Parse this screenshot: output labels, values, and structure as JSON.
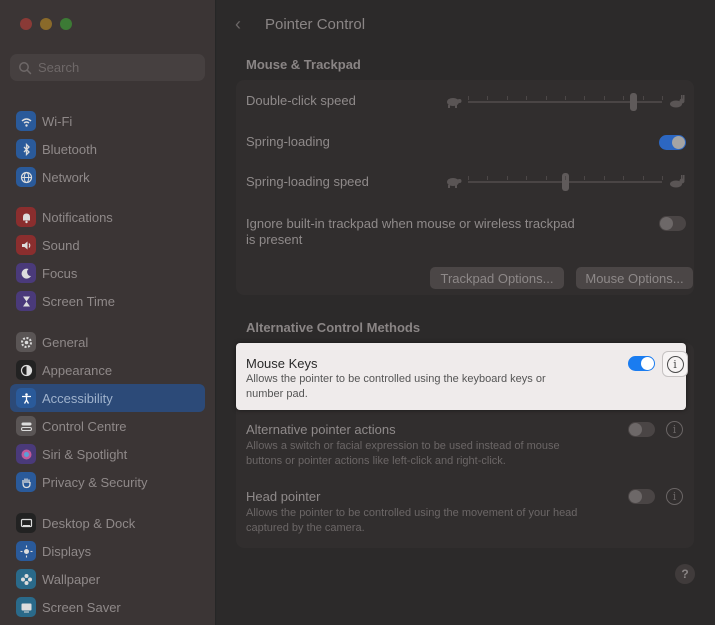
{
  "sidebar": {
    "search_placeholder": "Search",
    "groups": [
      [
        {
          "label": "Wi-Fi",
          "icon": "wifi-icon",
          "color": "#2a5a9a"
        },
        {
          "label": "Bluetooth",
          "icon": "bluetooth-icon",
          "color": "#2a5a9a"
        },
        {
          "label": "Network",
          "icon": "globe-icon",
          "color": "#2a5a9a"
        }
      ],
      [
        {
          "label": "Notifications",
          "icon": "bell-icon",
          "color": "#8a2e2e"
        },
        {
          "label": "Sound",
          "icon": "speaker-icon",
          "color": "#8a2e2e"
        },
        {
          "label": "Focus",
          "icon": "moon-icon",
          "color": "#4a3a7a"
        },
        {
          "label": "Screen Time",
          "icon": "hourglass-icon",
          "color": "#4a3a7a"
        }
      ],
      [
        {
          "label": "General",
          "icon": "gear-icon",
          "color": "#5a5555"
        },
        {
          "label": "Appearance",
          "icon": "appearance-icon",
          "color": "#222222"
        },
        {
          "label": "Accessibility",
          "icon": "accessibility-icon",
          "color": "#2a5a9a"
        },
        {
          "label": "Control Centre",
          "icon": "control-centre-icon",
          "color": "#5a5555"
        },
        {
          "label": "Siri & Spotlight",
          "icon": "siri-icon",
          "color": "#4a3a7a"
        },
        {
          "label": "Privacy & Security",
          "icon": "hand-icon",
          "color": "#2a5a9a"
        }
      ],
      [
        {
          "label": "Desktop & Dock",
          "icon": "desktop-icon",
          "color": "#222222"
        },
        {
          "label": "Displays",
          "icon": "sun-icon",
          "color": "#2a5a9a"
        },
        {
          "label": "Wallpaper",
          "icon": "flower-icon",
          "color": "#2a6a8a"
        },
        {
          "label": "Screen Saver",
          "icon": "screensaver-icon",
          "color": "#2a6a8a"
        }
      ]
    ],
    "active": "Accessibility"
  },
  "header": {
    "back_label": "‹",
    "title": "Pointer Control"
  },
  "mouse_trackpad": {
    "section_title": "Mouse & Trackpad",
    "double_click_label": "Double-click speed",
    "double_click_value": 0.85,
    "spring_loading_label": "Spring-loading",
    "spring_loading_on": true,
    "spring_loading_speed_label": "Spring-loading speed",
    "spring_loading_speed_value": 0.5,
    "ignore_trackpad_label_1": "Ignore built-in trackpad when mouse or wireless trackpad",
    "ignore_trackpad_label_2": "is present",
    "ignore_trackpad_on": false,
    "trackpad_options_label": "Trackpad Options...",
    "mouse_options_label": "Mouse Options..."
  },
  "alt_control": {
    "section_title": "Alternative Control Methods",
    "mouse_keys_label": "Mouse Keys",
    "mouse_keys_desc_1": "Allows the pointer to be controlled using the keyboard keys or",
    "mouse_keys_desc_2": "number pad.",
    "mouse_keys_on": true,
    "alt_pointer_label": "Alternative pointer actions",
    "alt_pointer_desc_1": "Allows a switch or facial expression to be used instead of mouse",
    "alt_pointer_desc_2": "buttons or pointer actions like left-click and right-click.",
    "alt_pointer_on": false,
    "head_pointer_label": "Head pointer",
    "head_pointer_desc_1": "Allows the pointer to be controlled using the movement of your head",
    "head_pointer_desc_2": "captured by the camera.",
    "head_pointer_on": false,
    "info_glyph": "i"
  },
  "help_label": "?"
}
